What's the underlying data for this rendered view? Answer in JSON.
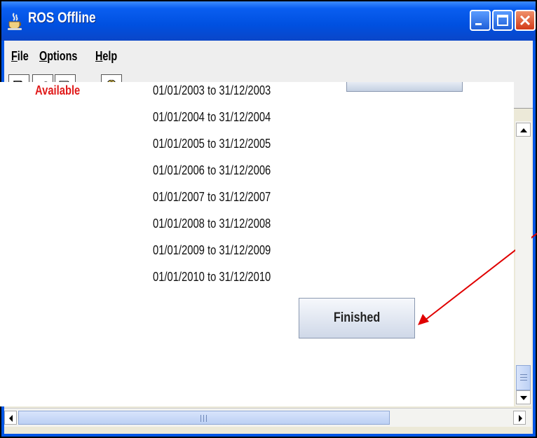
{
  "window": {
    "title": "ROS Offline",
    "app_icon": "java-cup-icon",
    "controls": [
      "minimize-icon",
      "maximize-icon",
      "close-icon"
    ]
  },
  "menu": {
    "file": "File",
    "options": "Options",
    "help": "Help"
  },
  "toolbar": {
    "icons": [
      "new-document-icon",
      "open-folder-icon",
      "save-icon",
      "help-question-icon"
    ]
  },
  "content": {
    "status_label": "Available",
    "status_color": "#e01a1a",
    "periods": [
      "01/01/2003 to 31/12/2003",
      "01/01/2004 to 31/12/2004",
      "01/01/2005 to 31/12/2005",
      "01/01/2006 to 31/12/2006",
      "01/01/2007 to 31/12/2007",
      "01/01/2008 to 31/12/2008",
      "01/01/2009 to 31/12/2009",
      "01/01/2010 to 31/12/2010"
    ],
    "finished_button": "Finished"
  },
  "annotation": {
    "arrow_color": "#e00000"
  },
  "colors": {
    "titlebar": "#0a5ef0",
    "window_bg": "#ece9d8"
  }
}
